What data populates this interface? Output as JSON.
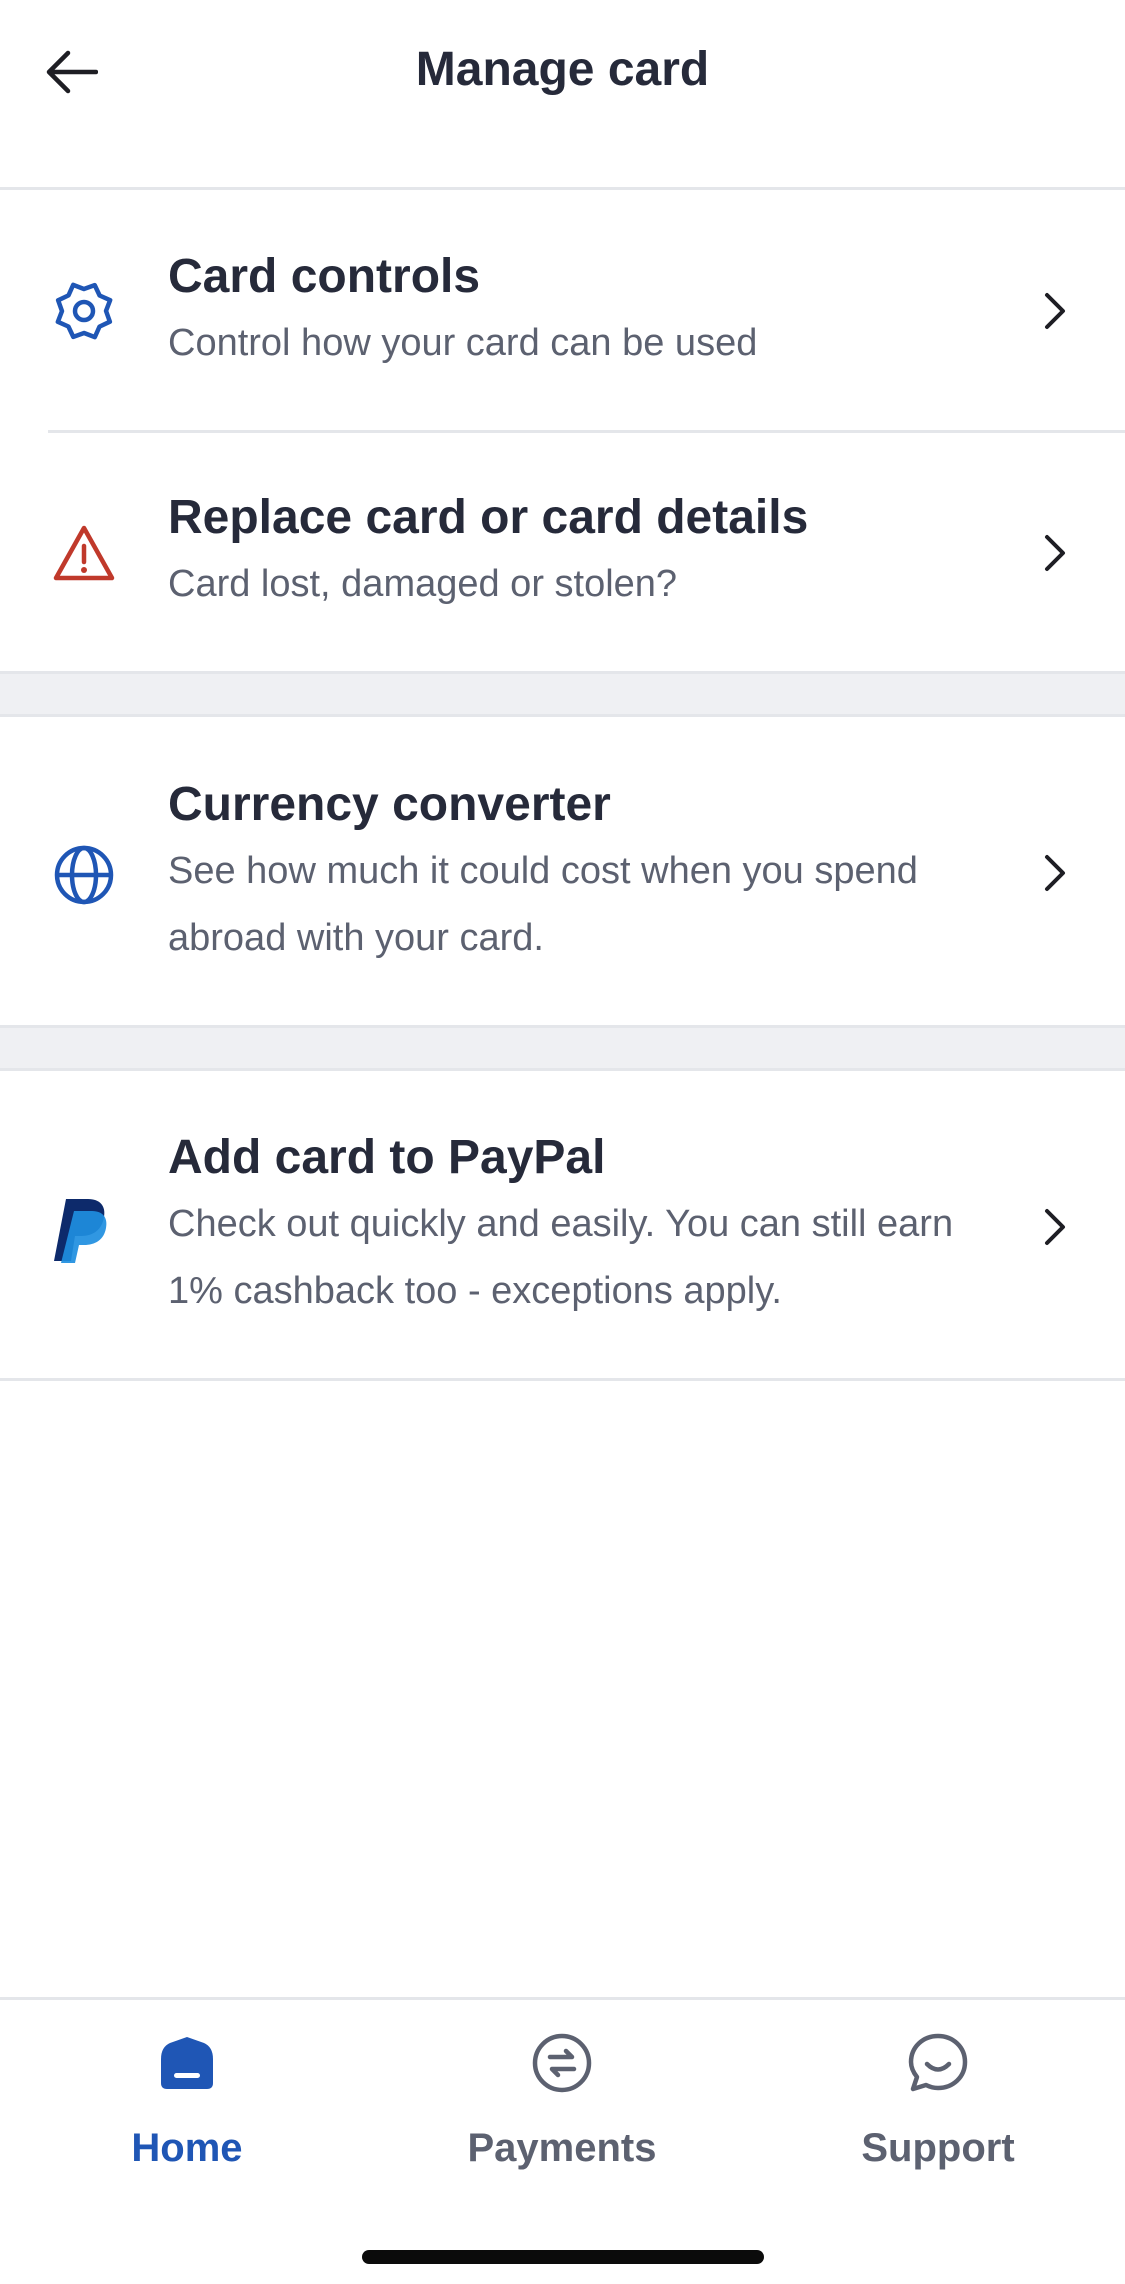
{
  "header": {
    "title": "Manage card",
    "back_icon": "arrow-left-icon"
  },
  "rows": [
    {
      "icon": "gear-icon",
      "title": "Card controls",
      "subtitle": "Control how your card can be used"
    },
    {
      "icon": "warning-triangle-icon",
      "title": "Replace card or card details",
      "subtitle": "Card lost, damaged or stolen?"
    },
    {
      "icon": "globe-icon",
      "title": "Currency converter",
      "subtitle": "See how much it could cost when you spend abroad with your card."
    },
    {
      "icon": "paypal-logo-icon",
      "title": "Add card to PayPal",
      "subtitle": "Check out quickly and easily. You can still earn 1% cashback too - exceptions apply."
    }
  ],
  "tabbar": {
    "tabs": [
      {
        "label": "Home",
        "icon": "home-icon",
        "active": true
      },
      {
        "label": "Payments",
        "icon": "transfer-icon",
        "active": false
      },
      {
        "label": "Support",
        "icon": "chat-icon",
        "active": false
      }
    ]
  },
  "colors": {
    "accent": "#1f56b5",
    "warning": "#c0392b",
    "text_primary": "#262a3a",
    "text_secondary": "#5c6170",
    "divider": "#e4e6ea",
    "section_bg": "#eff0f3"
  }
}
